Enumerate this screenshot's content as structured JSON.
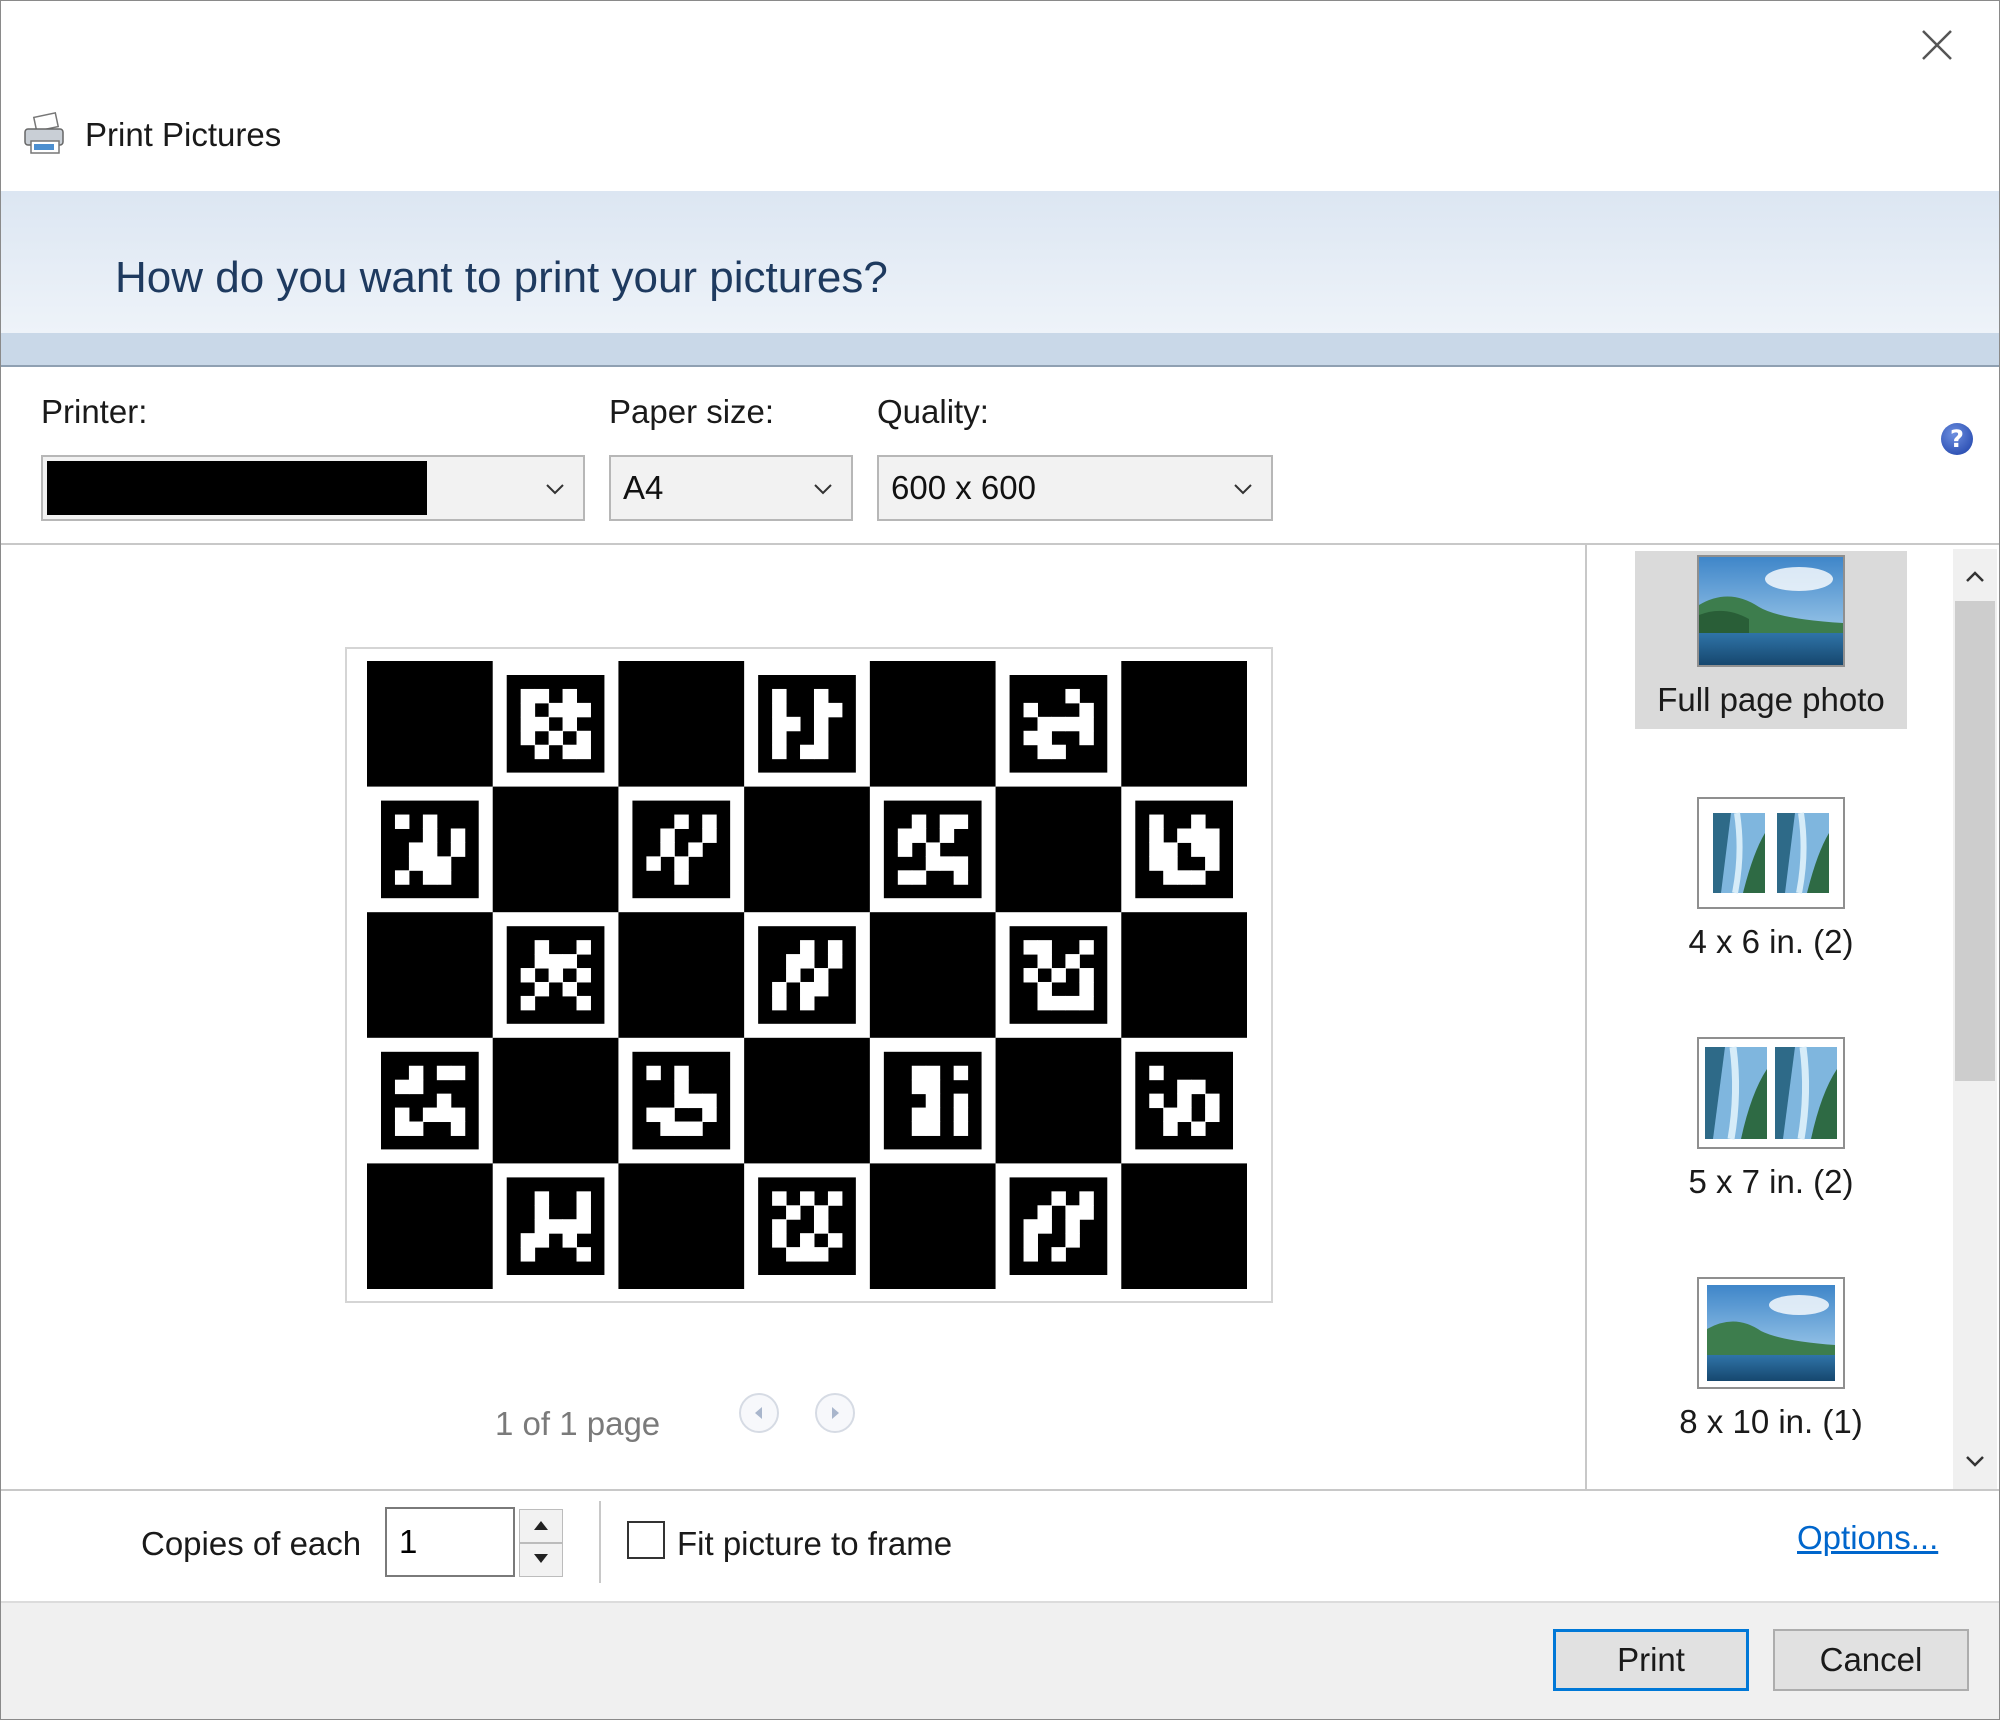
{
  "window": {
    "title": "Print Pictures",
    "question": "How do you want to print your pictures?"
  },
  "settings": {
    "printer_label": "Printer:",
    "printer_value": "",
    "paper_size_label": "Paper size:",
    "paper_size_value": "A4",
    "quality_label": "Quality:",
    "quality_value": "600 x 600",
    "help_glyph": "?"
  },
  "preview": {
    "pager_text": "1 of 1 page",
    "image_description": "checkerboard-aruco-markers"
  },
  "layouts": {
    "items": [
      {
        "label": "Full page photo",
        "selected": true
      },
      {
        "label": "4 x 6 in. (2)",
        "selected": false
      },
      {
        "label": "5 x 7 in. (2)",
        "selected": false
      },
      {
        "label": "8 x 10 in. (1)",
        "selected": false
      }
    ]
  },
  "options": {
    "copies_label": "Copies of each",
    "copies_value": "1",
    "fit_label": "Fit picture to frame",
    "fit_checked": false,
    "options_link": "Options..."
  },
  "buttons": {
    "print": "Print",
    "cancel": "Cancel"
  },
  "colors": {
    "accent": "#0078d7",
    "question_text": "#1e3a5f",
    "banner": "#dce6f2"
  }
}
